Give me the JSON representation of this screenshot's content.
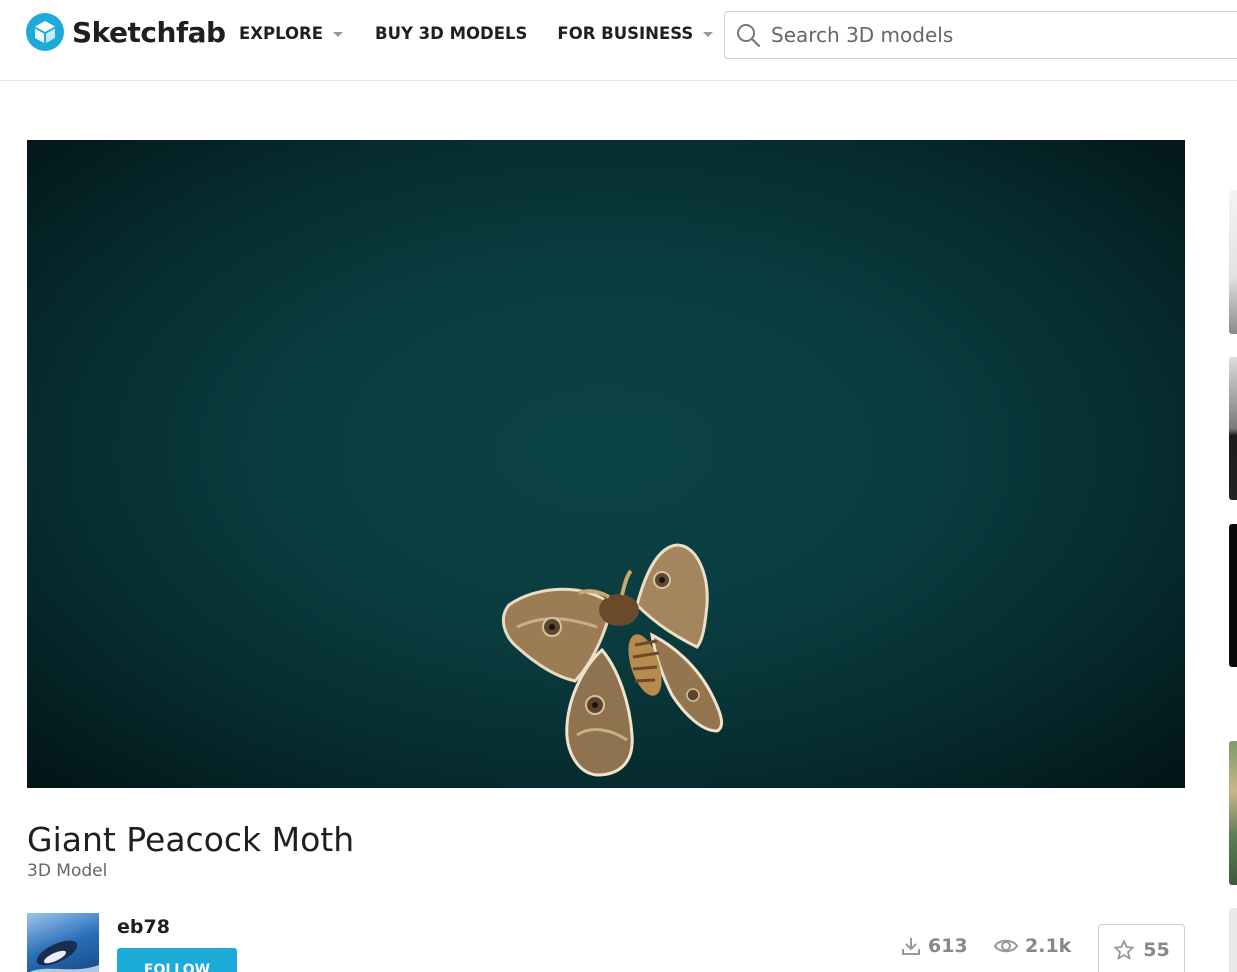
{
  "header": {
    "brand": "Sketchfab",
    "nav": {
      "explore": "EXPLORE",
      "buy": "BUY 3D MODELS",
      "business": "FOR BUSINESS"
    },
    "search": {
      "placeholder": "Search 3D models"
    }
  },
  "model": {
    "title": "Giant Peacock Moth",
    "type": "3D Model"
  },
  "author": {
    "name": "eb78",
    "follow_label": "FOLLOW"
  },
  "stats": {
    "downloads": "613",
    "views": "2.1k",
    "likes": "55"
  },
  "colors": {
    "brand_blue": "#1caad9",
    "viewer_bg": "#0a3c3f"
  },
  "icons": [
    "sketchfab-logo-icon",
    "search-icon",
    "download-icon",
    "eye-icon",
    "star-icon"
  ]
}
